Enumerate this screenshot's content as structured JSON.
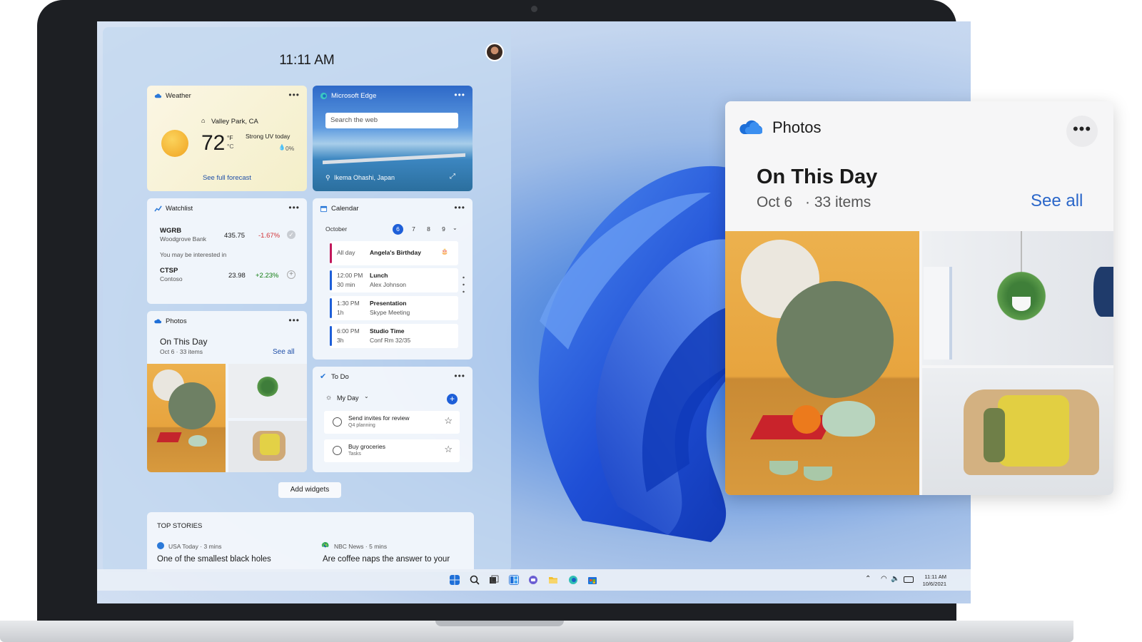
{
  "clock": {
    "time": "11:11 AM"
  },
  "weather": {
    "title": "Weather",
    "location": "Valley Park, CA",
    "temp": "72",
    "unit_f": "°F",
    "unit_c": "°C",
    "condition": "Strong UV today",
    "precip": "0%",
    "forecast_link": "See full forecast"
  },
  "edge": {
    "title": "Microsoft Edge",
    "search_placeholder": "Search the web",
    "image_location": "Ikema Ohashi, Japan"
  },
  "watchlist": {
    "title": "Watchlist",
    "stocks": [
      {
        "symbol": "WGRB",
        "name": "Woodgrove Bank",
        "price": "435.75",
        "change": "-1.67%"
      },
      {
        "symbol": "CTSP",
        "name": "Contoso",
        "price": "23.98",
        "change": "+2.23%"
      }
    ],
    "interest_label": "You may be interested in"
  },
  "calendar": {
    "title": "Calendar",
    "month": "October",
    "days": [
      "6",
      "7",
      "8",
      "9"
    ],
    "events": [
      {
        "time": "All day",
        "duration": "",
        "title": "Angela's Birthday",
        "detail": ""
      },
      {
        "time": "12:00 PM",
        "duration": "30 min",
        "title": "Lunch",
        "detail": "Alex Johnson"
      },
      {
        "time": "1:30 PM",
        "duration": "1h",
        "title": "Presentation",
        "detail": "Skype Meeting"
      },
      {
        "time": "6:00 PM",
        "duration": "3h",
        "title": "Studio Time",
        "detail": "Conf Rm 32/35"
      }
    ]
  },
  "photos_small": {
    "title": "Photos",
    "heading": "On This Day",
    "sub": "Oct 6  · 33 items",
    "see_all": "See all"
  },
  "todo": {
    "title": "To Do",
    "list": "My Day",
    "items": [
      {
        "title": "Send invites for review",
        "sub": "Q4 planning"
      },
      {
        "title": "Buy groceries",
        "sub": "Tasks"
      }
    ]
  },
  "add_widgets": "Add widgets",
  "stories": {
    "heading": "TOP STORIES",
    "items": [
      {
        "source": "USA Today · 3 mins",
        "headline": "One of the smallest black holes"
      },
      {
        "source": "NBC News · 5 mins",
        "headline": "Are coffee naps the answer to your"
      }
    ]
  },
  "taskbar": {
    "time": "11:11 AM",
    "date": "10/6/2021"
  },
  "photos_popout": {
    "title": "Photos",
    "heading": "On This Day",
    "date": "Oct 6",
    "count": "· 33 items",
    "see_all": "See all"
  },
  "colors": {
    "accent": "#2a66c9",
    "negative": "#d13438",
    "positive": "#107c10",
    "brand_blue": "#1e5fd8"
  }
}
